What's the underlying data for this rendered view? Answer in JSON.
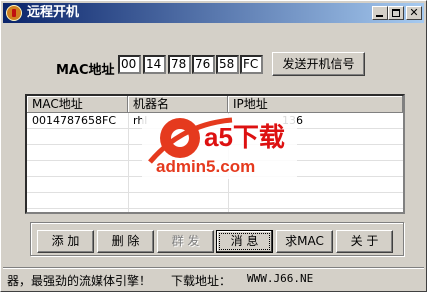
{
  "window": {
    "title": "远程开机"
  },
  "mac": {
    "label": "MAC地址",
    "fields": [
      "00",
      "14",
      "78",
      "76",
      "58",
      "FC"
    ],
    "send_button": "发送开机信号"
  },
  "list": {
    "columns": [
      "MAC地址",
      "机器名",
      "IP地址"
    ],
    "rows": [
      {
        "mac": "0014787658FC",
        "name": "rhl",
        "ip": "136"
      }
    ]
  },
  "watermark": {
    "brand": "a5下载",
    "site": "admin5.com"
  },
  "buttons": {
    "add": "添 加",
    "delete": "删 除",
    "broadcast": "群 发",
    "message": "消 息",
    "get_mac": "求MAC",
    "close": "关 于"
  },
  "status": {
    "message": "器，最强劲的流媒体引擎！",
    "download_label": "下载地址：",
    "download_url": "WWW.J66.NE"
  }
}
